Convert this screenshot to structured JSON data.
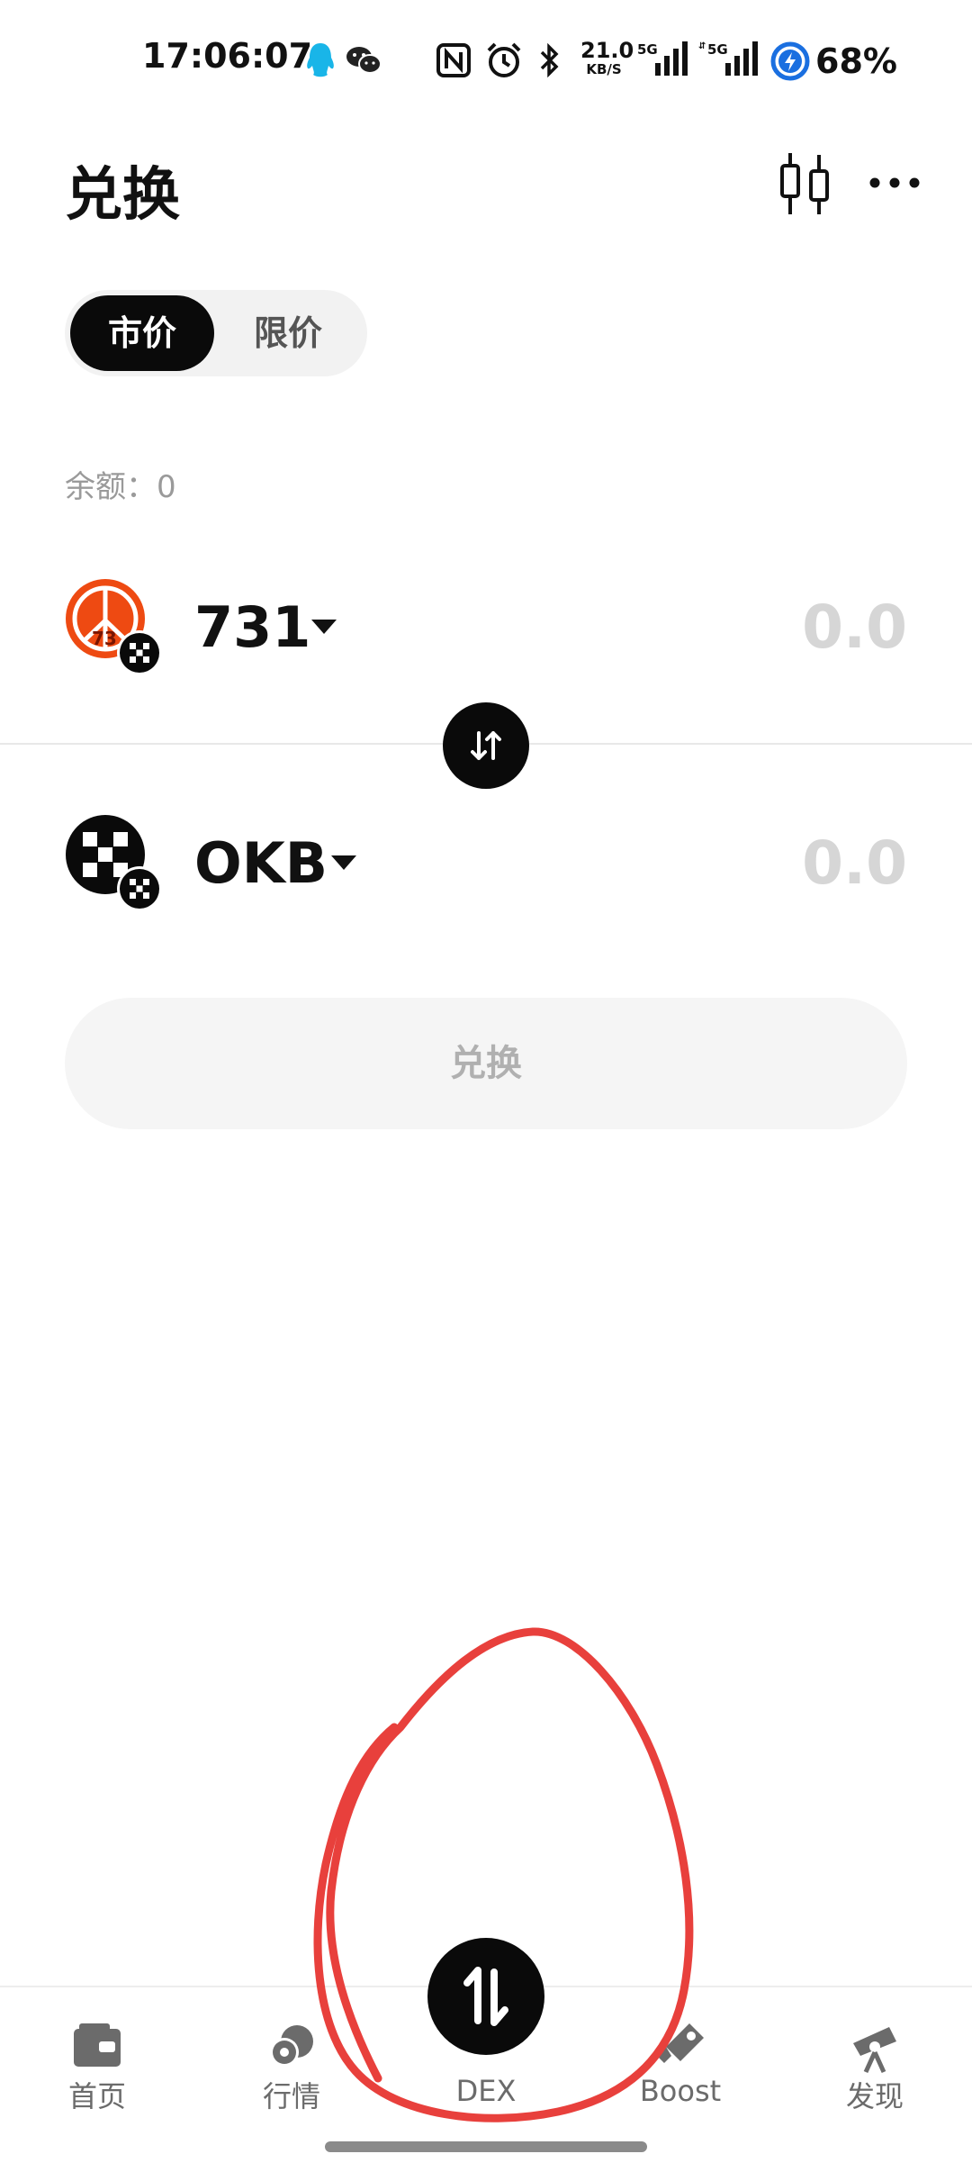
{
  "status_bar": {
    "time": "17:06:07",
    "net_speed_value": "21.0",
    "net_speed_unit": "KB/S",
    "signal_1_label": "5G",
    "signal_2_label": "5G",
    "battery_percent": "68%"
  },
  "header": {
    "title": "兑换",
    "chart_icon": "candlestick-chart-icon",
    "more_icon": "more-dots-icon"
  },
  "order_type_tabs": [
    {
      "label": "市价",
      "active": true
    },
    {
      "label": "限价",
      "active": false
    }
  ],
  "balance_label": "余额：0",
  "from_token": {
    "symbol": "731",
    "amount_placeholder": "0.0",
    "logo_accent": "#e8480f"
  },
  "to_token": {
    "symbol": "OKB",
    "amount_placeholder": "0.0"
  },
  "swap_button_label": "兑换",
  "bottom_nav": [
    {
      "label": "首页",
      "icon": "wallet-icon"
    },
    {
      "label": "行情",
      "icon": "market-coins-icon"
    },
    {
      "label": "DEX",
      "icon": "swap-arrows-icon",
      "active": true
    },
    {
      "label": "Boost",
      "icon": "rocket-tag-icon"
    },
    {
      "label": "发现",
      "icon": "telescope-icon"
    }
  ],
  "colors": {
    "primary": "#0a0a0a",
    "muted_text": "#9a9a9a",
    "placeholder": "#d6d6d6",
    "annotation_red": "#e8403c"
  }
}
